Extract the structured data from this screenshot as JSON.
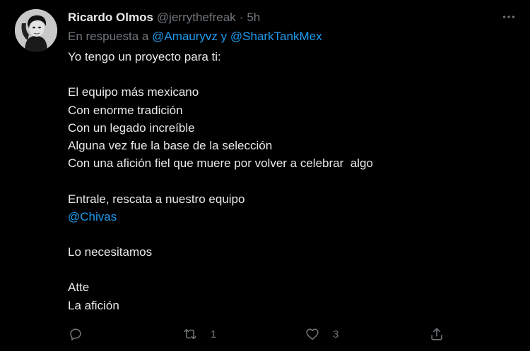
{
  "tweet": {
    "author_name": "Ricardo Olmos",
    "author_handle": "@jerrythefreak",
    "separator": "·",
    "time": "5h",
    "reply_prefix": "En respuesta a",
    "reply_mention_1": "@Amauryvz",
    "reply_conjunction": "y",
    "reply_mention_2": "@SharkTankMex",
    "lines": [
      "Yo tengo un proyecto para ti:",
      "",
      "El equipo más mexicano",
      "Con enorme tradición",
      "Con un legado increíble",
      "Alguna vez fue la base de la selección",
      "Con una afición fiel que muere por volver a celebrar  algo",
      "",
      "Entrale, rescata a nuestro equipo",
      "@Chivas",
      "",
      "Lo necesitamos",
      "",
      "Atte",
      "La afición"
    ],
    "retweet_count": "1",
    "like_count": "3"
  },
  "icons": {
    "more": "more-icon",
    "reply": "reply-icon",
    "retweet": "retweet-icon",
    "like": "heart-icon",
    "share": "share-icon"
  },
  "colors": {
    "background": "#000000",
    "text": "#e7e9ea",
    "secondary": "#71767b",
    "link": "#1d9bf0"
  }
}
